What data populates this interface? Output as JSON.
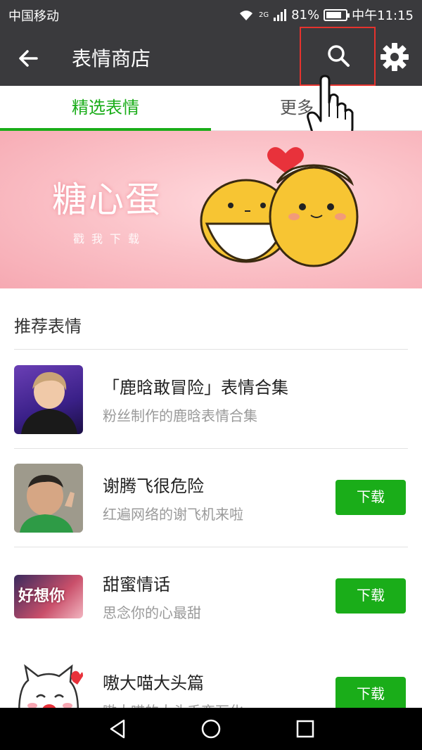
{
  "status_bar": {
    "carrier": "中国移动",
    "network": "2G",
    "battery": "81%",
    "battery_level": 0.81,
    "time": "中午11:15"
  },
  "app_bar": {
    "title": "表情商店",
    "icons": [
      "back-arrow-icon",
      "search-icon",
      "gear-icon"
    ]
  },
  "tabs": [
    {
      "label": "精选表情",
      "active": true
    },
    {
      "label": "更多",
      "active": false
    }
  ],
  "banner": {
    "title": "糖心蛋",
    "subtitle": "戳我下载"
  },
  "section": {
    "title": "推荐表情"
  },
  "items": [
    {
      "name": "「鹿晗敢冒险」表情合集",
      "desc": "粉丝制作的鹿晗表情合集",
      "button": ""
    },
    {
      "name": "谢腾飞很危险",
      "desc": "红遍网络的谢飞机来啦",
      "button": "下载"
    },
    {
      "name": "甜蜜情话",
      "desc": "思念你的心最甜",
      "button": "下载",
      "thumb_text": "好想你"
    },
    {
      "name": "嗷大喵大头篇",
      "desc": "嗷大喵的大头千变万化",
      "button": "下载"
    }
  ],
  "colors": {
    "accent": "#1aad19",
    "toolbar": "#3a3a3d",
    "highlight": "#e5322d"
  }
}
